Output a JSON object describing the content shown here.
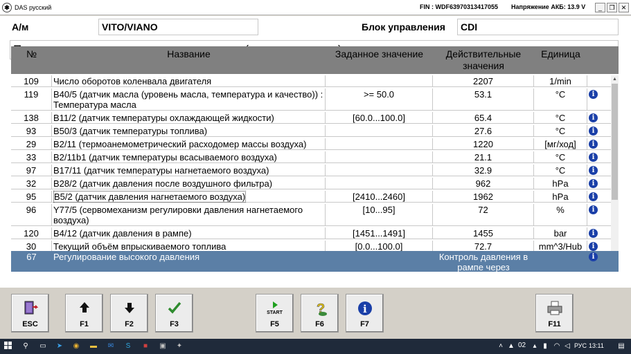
{
  "window": {
    "app_icon": "mercedes-star-icon",
    "title": "DAS русский",
    "fin": "FIN : WDF63970313417055",
    "battery": "Напряжение АКБ: 13.9 V",
    "min_btn": "_",
    "restore_btn": "❐",
    "close_btn": "✕"
  },
  "header": {
    "vehicle_label": "А/м",
    "vehicle_value": "VITO/VIANO",
    "block_label": "Блок управления",
    "block_value": "CDI"
  },
  "instruction": "Проверить двигатель в режиме движения (полная нагрузка).",
  "table": {
    "columns": {
      "no": "№",
      "name": "Название",
      "setpoint": "Заданное значение",
      "actual": "Действительные значения",
      "unit": "Единица"
    },
    "rows": [
      {
        "no": "109",
        "name": "Число оборотов коленвала двигателя",
        "set": "",
        "act": "2207",
        "unit": "1/min",
        "info": false
      },
      {
        "no": "119",
        "name": "B40/5 (датчик масла (уровень масла, температура и качество)) : Температура масла",
        "set": ">= 50.0",
        "act": "53.1",
        "unit": "°C",
        "info": true
      },
      {
        "no": "138",
        "name": "B11/2 (датчик температуры охлаждающей жидкости)",
        "set": "[60.0...100.0]",
        "act": "65.4",
        "unit": "°C",
        "info": true
      },
      {
        "no": "93",
        "name": "B50/3 (датчик температуры топлива)",
        "set": "",
        "act": "27.6",
        "unit": "°C",
        "info": true
      },
      {
        "no": "29",
        "name": "B2/11 (термоанемометрический расходомер массы воздуха)",
        "set": "",
        "act": "1220",
        "unit": "[мг/ход]",
        "info": true
      },
      {
        "no": "33",
        "name": "B2/11b1 (датчик температуры всасываемого воздуха)",
        "set": "",
        "act": "21.1",
        "unit": "°C",
        "info": true
      },
      {
        "no": "97",
        "name": "B17/11 (датчик температуры нагнетаемого воздуха)",
        "set": "",
        "act": "32.9",
        "unit": "°C",
        "info": true
      },
      {
        "no": "32",
        "name": "B28/2 (датчик давления после воздушного фильтра)",
        "set": "",
        "act": "962",
        "unit": "hPa",
        "info": true
      },
      {
        "no": "95",
        "name": "B5/2 (датчик давления нагнетаемого воздуха)",
        "set": "[2410...2460]",
        "act": "1962",
        "unit": "hPa",
        "info": true
      },
      {
        "no": "96",
        "name": "Y77/5 (сервомеханизм регулировки давления нагнетаемого воздуха)",
        "set": "[10...95]",
        "act": "72",
        "unit": "%",
        "info": true
      },
      {
        "no": "120",
        "name": "B4/12 (датчик давления в рампе)",
        "set": "[1451...1491]",
        "act": "1455",
        "unit": "bar",
        "info": true
      },
      {
        "no": "30",
        "name": "Текущий объём впрыскиваемого топлива",
        "set": "[0.0...100.0]",
        "act": "72.7",
        "unit": "mm^3/Hub",
        "info": true
      }
    ],
    "selected_row": {
      "no": "67",
      "name": "Регулирование высокого давления",
      "set": "",
      "act": "Контроль давления в рампе через",
      "unit": "",
      "info": true
    }
  },
  "toolbar": {
    "esc": "ESC",
    "f1": "F1",
    "f2": "F2",
    "f3": "F3",
    "f5": "F5",
    "f5_start": "START",
    "f6": "F6",
    "f7": "F7",
    "f11": "F11"
  },
  "taskbar": {
    "keyboard_num": "02",
    "lang": "РУС",
    "time": "13:11"
  },
  "colors": {
    "header_bg": "#808080",
    "selected_row_bg": "#5b7fa6",
    "info_icon": "#1a3fa8",
    "check_green": "#2e8b2e"
  }
}
